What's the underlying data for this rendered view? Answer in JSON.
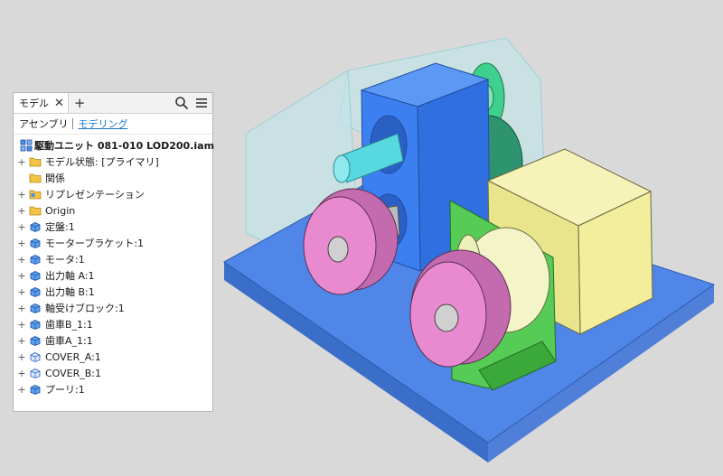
{
  "browser": {
    "tab_label": "モデル",
    "close_glyph": "✕",
    "add_glyph": "+",
    "tools": [
      "search-icon",
      "menu-icon"
    ],
    "modes": [
      {
        "label": "アセンブリ",
        "active": false
      },
      {
        "label": "モデリング",
        "active": true
      }
    ],
    "tree_root": {
      "label": "駆動ユニット 081-010 LOD200.iam",
      "icon": "assembly-icon"
    },
    "tree_items": [
      {
        "label": "モデル状態: [プライマリ]",
        "icon": "folder-icon",
        "expand": "+"
      },
      {
        "label": "関係",
        "icon": "folder-icon",
        "expand": ""
      },
      {
        "label": "リプレゼンテーション",
        "icon": "representation-folder-icon",
        "expand": "+"
      },
      {
        "label": "Origin",
        "icon": "folder-icon",
        "expand": "+"
      },
      {
        "label": "定盤:1",
        "icon": "part-icon",
        "expand": "+"
      },
      {
        "label": "モーターブラケット:1",
        "icon": "part-icon",
        "expand": "+"
      },
      {
        "label": "モータ:1",
        "icon": "part-icon",
        "expand": "+"
      },
      {
        "label": "出力軸 A:1",
        "icon": "part-icon",
        "expand": "+"
      },
      {
        "label": "出力軸 B:1",
        "icon": "part-icon",
        "expand": "+"
      },
      {
        "label": "軸受けブロック:1",
        "icon": "part-icon",
        "expand": "+"
      },
      {
        "label": "歯車B_1:1",
        "icon": "part-icon",
        "expand": "+"
      },
      {
        "label": "歯車A_1:1",
        "icon": "part-icon",
        "expand": "+"
      },
      {
        "label": "COVER_A:1",
        "icon": "wire-part-icon",
        "expand": "+"
      },
      {
        "label": "COVER_B:1",
        "icon": "wire-part-icon",
        "expand": "+"
      },
      {
        "label": "プーリ:1",
        "icon": "part-icon",
        "expand": "+"
      }
    ]
  },
  "colors": {
    "viewport_bg": "#d9d9d9",
    "base_plate": "#4f86e8",
    "bearing_block": "#3c7ff0",
    "motor_box": "#f2ee9c",
    "bracket": "#56cc56",
    "pulley": "#e98ad0",
    "gear": "#3fcf8e",
    "shaft": "#58d8e0",
    "cover": "#bfe6ea",
    "accent": "#1a76d2"
  }
}
